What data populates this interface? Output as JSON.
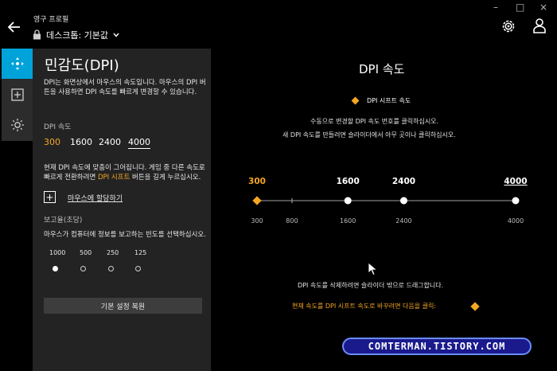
{
  "header": {
    "title": "영구 프로필",
    "profile_name": "데스크톱: 기본값"
  },
  "window_controls": [
    "–",
    "□",
    "×"
  ],
  "rail": {
    "items": [
      {
        "icon": "dpi-arrows-icon",
        "active": true
      },
      {
        "icon": "plus-square-icon",
        "active": false
      },
      {
        "icon": "lighting-icon",
        "active": false
      }
    ]
  },
  "panel": {
    "title": "민감도(DPI)",
    "description": "DPI는 화면상에서 마우스의 속도입니다. 마우스의 DPI 버튼을 사용하면 DPI 속도를 빠르게 변경할 수 있습니다.",
    "dpi_speed_label": "DPI 속도",
    "dpi_values": [
      "300",
      "1600",
      "2400",
      "4000"
    ],
    "mode_desc_pre": "현재 DPI 속도에 맞춤이 그어집니다. 게임 중 다른 속도로 빠르게 전환하려면 ",
    "mode_desc_orange": "DPI 시프트",
    "mode_desc_post": " 버튼을 길게 누르십시오.",
    "assign_link": "마우스에 할당하기",
    "report_label": "보고율(초당)",
    "report_desc": "마우스가 컴퓨터에 정보를 보고하는 빈도를 선택하십시오.",
    "report_rates": [
      "1000",
      "500",
      "250",
      "125"
    ],
    "report_selected": "1000",
    "reset_button": "기본 설정 복원"
  },
  "main": {
    "title": "DPI 속도",
    "shift_label": "DPI 시프트 속도",
    "instruction1": "수동으로 변경할 DPI 속도 번호를 클릭하십시오.",
    "instruction2": "새 DPI 속도를 만들려면 슬라이더에서 아무 곳이나 클릭하십시오.",
    "drag_hint": "DPI 속도를 삭제하려면 슬라이더 밖으로 드래그합니다.",
    "shift_hint": "현재 속도를 DPI 시프트 속도로 바꾸려면 다음을 클릭:"
  },
  "slider": {
    "min": 300,
    "max": 4000,
    "stops": [
      {
        "value": 300,
        "label": "300",
        "type": "shift"
      },
      {
        "value": 1600,
        "label": "1600",
        "type": "normal"
      },
      {
        "value": 2400,
        "label": "2400",
        "type": "normal"
      },
      {
        "value": 4000,
        "label": "4000",
        "type": "current"
      }
    ],
    "axis_ticks": [
      {
        "value": 300,
        "label": "300"
      },
      {
        "value": 800,
        "label": "800"
      },
      {
        "value": 1600,
        "label": "1600"
      },
      {
        "value": 2400,
        "label": "2400"
      },
      {
        "value": 4000,
        "label": "4000"
      }
    ],
    "colors": {
      "shift": "#f5a623",
      "normal": "#ffffff",
      "track": "#6a6a6a"
    }
  },
  "watermark": "COMTERMAN.TISTORY.COM"
}
